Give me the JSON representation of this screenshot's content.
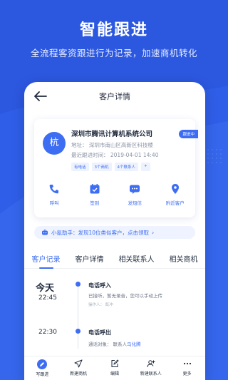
{
  "promo": {
    "title": "智能跟进",
    "subtitle": "全流程客资跟进行为记录，加速商机转化"
  },
  "nav": {
    "title": "客户详情",
    "back_icon": "back-arrow-icon"
  },
  "customer": {
    "avatar_char": "杭",
    "company": "深圳市腾讯计算机系统公司",
    "stage_badge": "跟进中",
    "address": "地址：  深圳市南山区高新区科技楼",
    "last_follow": "最近跟进时间：  2019-04-01 14:40",
    "tags": [
      "有电话",
      "3个商机",
      "4个联系人",
      "+"
    ]
  },
  "actions": [
    {
      "label": "呼叫",
      "icon": "phone-icon"
    },
    {
      "label": "签到",
      "icon": "checkin-icon"
    },
    {
      "label": "发短信",
      "icon": "sms-icon"
    },
    {
      "label": "附近客户",
      "icon": "location-icon"
    }
  ],
  "assistant": {
    "text": "小氪助手：发现10位类似客户，点击领取",
    "icon": "robot-icon"
  },
  "tabs": [
    "客户记录",
    "客户详情",
    "相关联系人",
    "相关商机"
  ],
  "active_tab": "客户记录",
  "timeline": {
    "day": "今天",
    "records": [
      {
        "time": "22:45",
        "title": "电话呼入",
        "desc": "已接听，暂无录音，您可以手动上传",
        "meta": "操作人：    既冲"
      },
      {
        "time": "22:30",
        "title": "电话呼出",
        "desc_prefix": "通话对象：  联系人",
        "contact": "马化腾"
      }
    ]
  },
  "bottom_bar": [
    {
      "label": "写跟进",
      "icon": "write-icon"
    },
    {
      "label": "新建商机",
      "icon": "send-icon"
    },
    {
      "label": "编辑",
      "icon": "edit-icon"
    },
    {
      "label": "新建联系人",
      "icon": "add-contact-icon"
    },
    {
      "label": "更多",
      "icon": "more-icon"
    }
  ],
  "colors": {
    "background": "#2f5ee8",
    "accent": "#3d6df2"
  }
}
